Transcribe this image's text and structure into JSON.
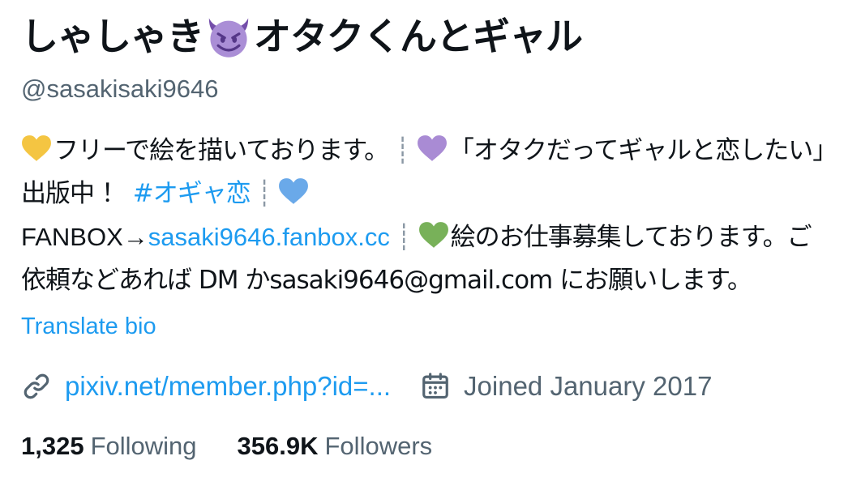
{
  "profile": {
    "name_part1": "しゃしゃき",
    "name_emoji": "smiling-devil-icon",
    "name_part2": "オタクくんとギャル",
    "handle": "@sasakisaki9646"
  },
  "bio": {
    "text1": "フリーで絵を描いております。",
    "sep": "┊",
    "text2": "「オタクだってギャルと恋したい」出版中 ！ ",
    "hashtag": "#オギャ恋",
    "text3": "FANBOX→",
    "fanbox_link": "sasaki9646.fanbox.cc",
    "text4": "絵のお仕事募集しております。ご依頼などあれば DM かsasaki9646@gmail.com にお願いします。",
    "hearts": {
      "yellow": "#f4c542",
      "purple": "#a98bd4",
      "blue": "#6aa9e9",
      "green": "#78b159"
    }
  },
  "translate_label": "Translate bio",
  "meta": {
    "website": "pixiv.net/member.php?id=...",
    "joined": "Joined January 2017"
  },
  "stats": {
    "following_count": "1,325",
    "following_label": "Following",
    "followers_count": "356.9K",
    "followers_label": "Followers"
  },
  "colors": {
    "text": "#0f1419",
    "secondary": "#536471",
    "accent": "#1d9bf0"
  }
}
